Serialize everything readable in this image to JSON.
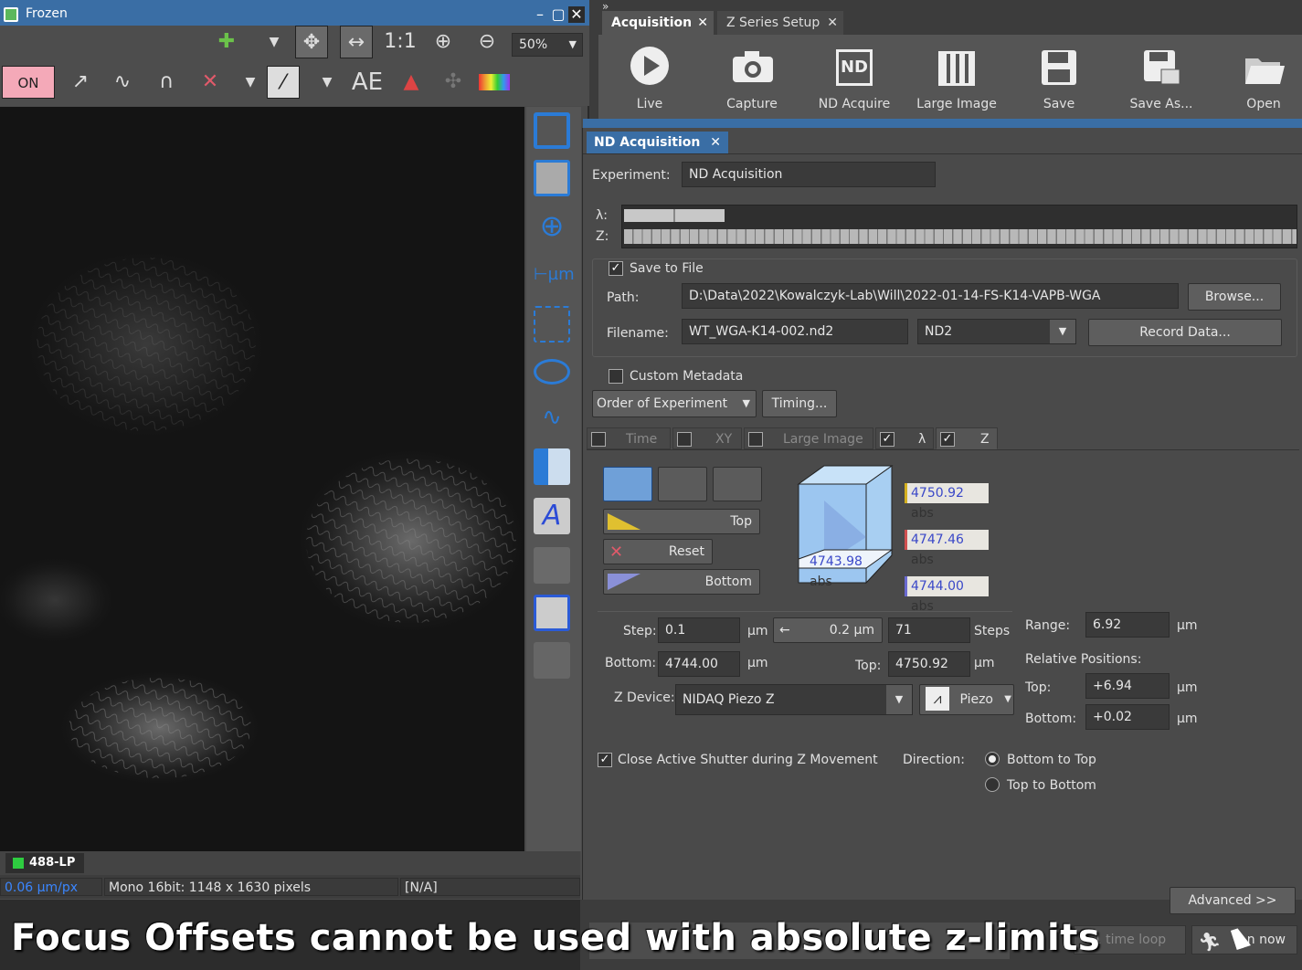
{
  "left_window": {
    "title": "Frozen",
    "zoom_1to1": "1:1",
    "zoom_level": "50%",
    "toolbar2": {
      "on_label": "ON",
      "ae_label": "AE"
    },
    "channel_tab": "488-LP",
    "status": {
      "scale": "0.06 µm/px",
      "image_info": "Mono 16bit: 1148 x 1630 pixels",
      "value": "[N/A]"
    }
  },
  "right_window": {
    "tabs": [
      {
        "label": "Acquisition"
      },
      {
        "label": "Z Series Setup"
      }
    ],
    "toolbar": [
      {
        "label": "Live"
      },
      {
        "label": "Capture"
      },
      {
        "label": "ND Acquire"
      },
      {
        "label": "Large Image"
      },
      {
        "label": "Save"
      },
      {
        "label": "Save As..."
      },
      {
        "label": "Open"
      }
    ],
    "nd_icon_text": "ND"
  },
  "nd": {
    "tab": "ND Acquisition",
    "experiment_label": "Experiment:",
    "experiment_value": "ND Acquisition",
    "lambda_label": "λ:",
    "z_label": "Z:",
    "save_to_file_label": "Save to File",
    "save_to_file_checked": true,
    "path_label": "Path:",
    "path_value": "D:\\Data\\2022\\Kowalczyk-Lab\\Will\\2022-01-14-FS-K14-VAPB-WGA",
    "browse_label": "Browse...",
    "filename_label": "Filename:",
    "filename_value": "WT_WGA-K14-002.nd2",
    "format_value": "ND2",
    "record_data_label": "Record Data...",
    "custom_metadata_label": "Custom Metadata",
    "order_label": "Order of Experiment",
    "timing_label": "Timing...",
    "subtabs": [
      {
        "label": "Time",
        "checked": false
      },
      {
        "label": "XY",
        "checked": false
      },
      {
        "label": "Large Image",
        "checked": false
      },
      {
        "label": "λ",
        "checked": true
      },
      {
        "label": "Z",
        "checked": true
      }
    ],
    "z": {
      "top_btn": "Top",
      "reset_btn": "Reset",
      "bottom_btn": "Bottom",
      "abs_word": "abs",
      "cube_values": {
        "top": "4750.92",
        "current": "4747.46",
        "home": "4743.98",
        "bottom": "4744.00"
      },
      "step_label": "Step:",
      "step_value": "0.1",
      "unit": "µm",
      "step_display": "0.2 µm",
      "steps_value": "71",
      "steps_label": "Steps",
      "bottom_label": "Bottom:",
      "bottom_value": "4744.00",
      "top_label": "Top:",
      "top_value": "4750.92",
      "range_label": "Range:",
      "range_value": "6.92",
      "relative_label": "Relative Positions:",
      "rel_top_label": "Top:",
      "rel_top_value": "+6.94",
      "rel_bottom_label": "Bottom:",
      "rel_bottom_value": "+0.02",
      "device_label": "Z Device:",
      "device_value": "NIDAQ Piezo Z",
      "piezo_label": "Piezo",
      "close_shutter_label": "Close Active Shutter during Z Movement",
      "close_shutter_checked": true,
      "direction_label": "Direction:",
      "dir_options": [
        "Bottom to Top",
        "Top to Bottom"
      ],
      "dir_selected": 0
    },
    "advanced_label": "Advanced >>",
    "time_loop_label": "1 time loop",
    "run_now_label": "n now"
  },
  "caption": "Focus Offsets cannot be used with absolute z-limits"
}
